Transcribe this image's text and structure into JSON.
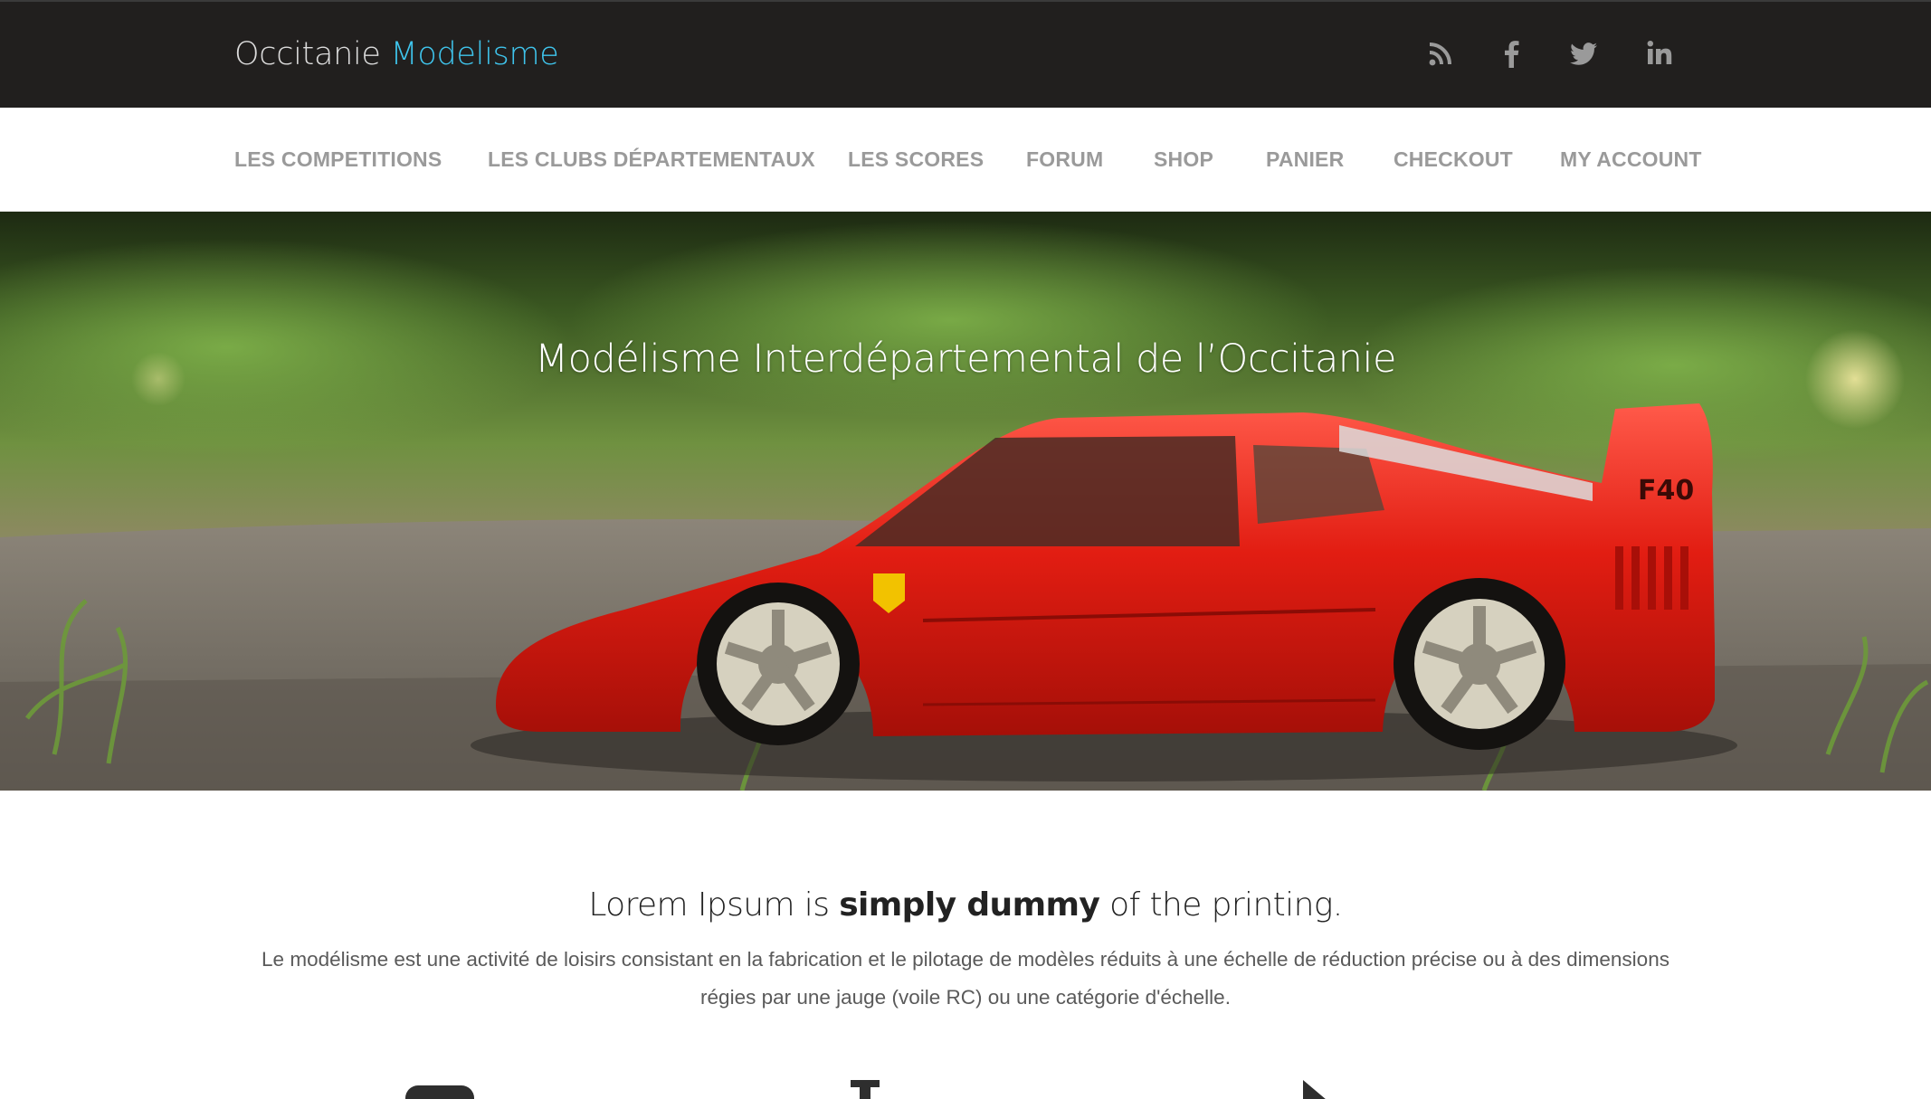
{
  "header": {
    "brand_part1": "Occitanie",
    "brand_part2": "Modelisme",
    "brand_accent_color": "#3fc4ec",
    "social": [
      {
        "name": "rss-icon"
      },
      {
        "name": "facebook-icon"
      },
      {
        "name": "twitter-icon"
      },
      {
        "name": "linkedin-icon"
      }
    ]
  },
  "nav": {
    "items": [
      {
        "label": "LES COMPETITIONS"
      },
      {
        "label": "LES CLUBS DÉPARTEMENTAUX"
      },
      {
        "label": "LES SCORES"
      },
      {
        "label": "FORUM"
      },
      {
        "label": "SHOP"
      },
      {
        "label": "PANIER"
      },
      {
        "label": "CHECKOUT"
      },
      {
        "label": "MY ACCOUNT"
      }
    ]
  },
  "hero": {
    "title": "Modélisme Interdépartemental de l’Occitanie",
    "image": "red-sports-car-model-photo",
    "car_badge": "F40"
  },
  "intro": {
    "headline_prefix": "Lorem Ipsum is ",
    "headline_bold": "simply dummy",
    "headline_suffix": " of the printing.",
    "paragraph": "Le modélisme est une activité de loisirs consistant en la fabrication et le pilotage de modèles réduits à une échelle de réduction précise ou à des dimensions régies par une jauge (voile RC) ou une catégorie d'échelle."
  },
  "features": {
    "icons": [
      {
        "name": "feature-icon-1"
      },
      {
        "name": "feature-icon-2"
      },
      {
        "name": "feature-icon-3"
      }
    ]
  }
}
